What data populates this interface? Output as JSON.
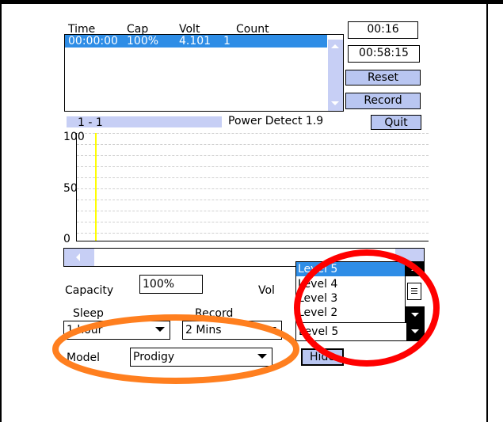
{
  "table": {
    "headers": [
      "Time",
      "Cap",
      "Volt",
      "Count"
    ],
    "rows": [
      [
        "00:00:00",
        "100%",
        "4.101",
        "1"
      ]
    ]
  },
  "buttons": {
    "timer1": "00:16",
    "timer2": "00:58:15",
    "reset": "Reset",
    "record": "Record",
    "quit": "Quit",
    "hide": "Hide"
  },
  "progress": {
    "label": "1 - 1",
    "fill_percent": 100
  },
  "app_title": "Power Detect 1.9",
  "graph": {
    "y_ticks": [
      "100",
      "50",
      "0"
    ],
    "cursor_color": "#ffff00"
  },
  "capacity": {
    "label": "Capacity",
    "value": "100%"
  },
  "volt": {
    "label": "Vol"
  },
  "sleep": {
    "label": "Sleep",
    "value": "1 hour"
  },
  "record_interval": {
    "label": "Record",
    "value": "2 Mins"
  },
  "model": {
    "label": "Model",
    "value": "Prodigy"
  },
  "level_dropdown": {
    "options": [
      "Level 5",
      "Level 4",
      "Level 3",
      "Level 2"
    ],
    "selected": "Level 5"
  },
  "colors": {
    "selection": "#2e8de6",
    "button_fill": "#b9c6f1",
    "scrollbar": "#c7cff5",
    "annotation_red": "#ff0000",
    "annotation_orange": "#ff7f1f"
  }
}
